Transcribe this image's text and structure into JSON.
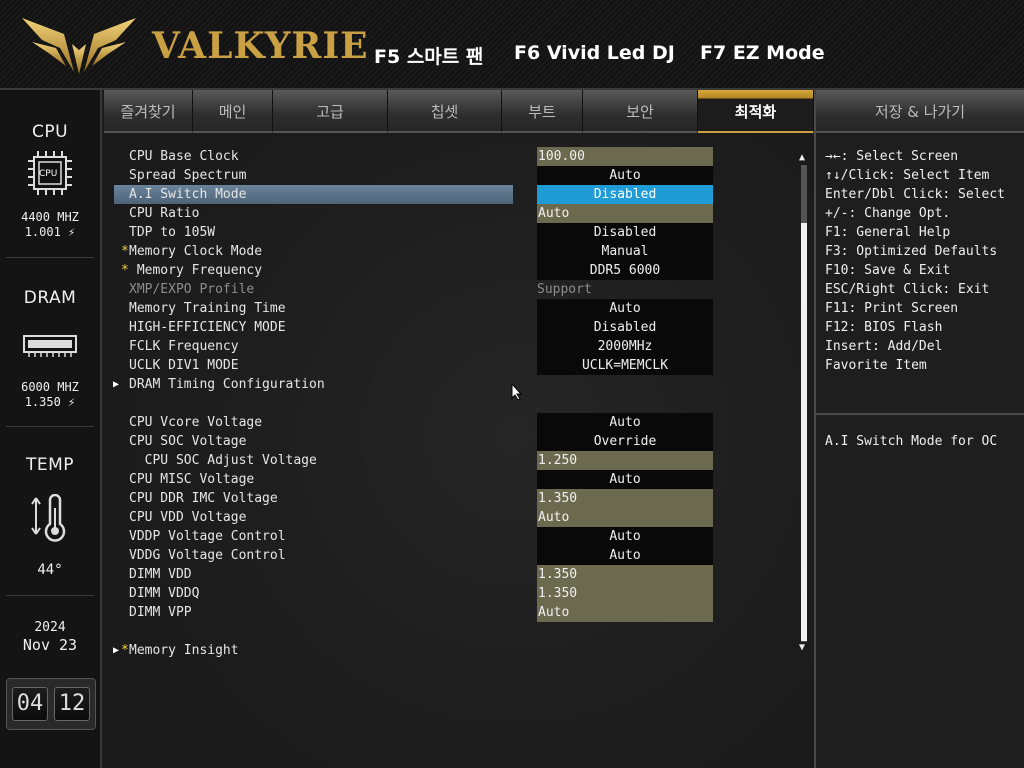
{
  "header": {
    "logo_text": "VALKYRIE",
    "hotkeys": [
      "F5 스마트 팬",
      "F6 Vivid Led DJ",
      "F7 EZ Mode"
    ]
  },
  "left_panel": {
    "cpu": {
      "title": "CPU",
      "chip_label": "CPU",
      "freq": "4400 MHZ",
      "voltage": "1.001 ⚡"
    },
    "dram": {
      "title": "DRAM",
      "freq": "6000 MHZ",
      "voltage": "1.350 ⚡"
    },
    "temp": {
      "title": "TEMP",
      "value": "44°"
    },
    "date": {
      "year": "2024",
      "month_day": "Nov  23"
    },
    "clock": {
      "hour": "04",
      "minute": "12"
    }
  },
  "tabs": [
    "즐겨찾기",
    "메인",
    "고급",
    "칩셋",
    "부트",
    "보안",
    "최적화",
    "저장 & 나가기"
  ],
  "active_tab": "최적화",
  "settings": [
    {
      "label": "CPU Base Clock",
      "value": "100.00",
      "style": "olive"
    },
    {
      "label": "Spread Spectrum",
      "value": "Auto",
      "style": "dark"
    },
    {
      "label": "A.I Switch Mode",
      "value": "Disabled",
      "style": "selected"
    },
    {
      "label": "CPU Ratio",
      "value": "Auto",
      "style": "olive"
    },
    {
      "label": "TDP to 105W",
      "value": "Disabled",
      "style": "dark"
    },
    {
      "label": "Memory Clock Mode",
      "value": "Manual",
      "style": "dark",
      "star": "*"
    },
    {
      "label": " Memory Frequency",
      "value": "DDR5 6000",
      "style": "dark",
      "star": "*"
    },
    {
      "label": "XMP/EXPO Profile",
      "value": "Support",
      "style": "plain",
      "dim": true
    },
    {
      "label": "Memory Training Time",
      "value": "Auto",
      "style": "dark"
    },
    {
      "label": "HIGH-EFFICIENCY MODE",
      "value": "Disabled",
      "style": "dark"
    },
    {
      "label": "FCLK Frequency",
      "value": "2000MHz",
      "style": "dark"
    },
    {
      "label": "UCLK DIV1 MODE",
      "value": "UCLK=MEMCLK",
      "style": "dark"
    },
    {
      "label": "DRAM Timing Configuration",
      "value": "",
      "style": "submenu"
    },
    {
      "label": "",
      "value": "",
      "style": "blank"
    },
    {
      "label": "CPU Vcore Voltage",
      "value": "Auto",
      "style": "dark"
    },
    {
      "label": "CPU SOC Voltage",
      "value": "Override",
      "style": "dark"
    },
    {
      "label": "  CPU SOC Adjust Voltage",
      "value": "1.250",
      "style": "olive"
    },
    {
      "label": "CPU MISC Voltage",
      "value": "Auto",
      "style": "dark"
    },
    {
      "label": "CPU DDR IMC Voltage",
      "value": "1.350",
      "style": "olive"
    },
    {
      "label": "CPU VDD Voltage",
      "value": "Auto",
      "style": "olive"
    },
    {
      "label": "VDDP Voltage Control",
      "value": "Auto",
      "style": "dark"
    },
    {
      "label": "VDDG Voltage Control",
      "value": "Auto",
      "style": "dark"
    },
    {
      "label": "DIMM VDD",
      "value": "1.350",
      "style": "olive"
    },
    {
      "label": "DIMM VDDQ",
      "value": "1.350",
      "style": "olive"
    },
    {
      "label": "DIMM VPP",
      "value": "Auto",
      "style": "olive"
    },
    {
      "label": "",
      "value": "",
      "style": "blank"
    },
    {
      "label": "Memory Insight",
      "value": "",
      "style": "submenu",
      "star": "*"
    }
  ],
  "help": [
    "→←: Select Screen",
    "↑↓/Click: Select Item",
    "Enter/Dbl Click: Select",
    "+/-: Change Opt.",
    "F1: General Help",
    "F3: Optimized Defaults",
    "F10: Save & Exit",
    "ESC/Right Click: Exit",
    "F11: Print Screen",
    "F12: BIOS Flash",
    "Insert: Add/Del",
    "Favorite Item"
  ],
  "description": "A.I Switch Mode for OC",
  "scroll": {
    "up_icon": "▲",
    "down_icon": "▼"
  }
}
